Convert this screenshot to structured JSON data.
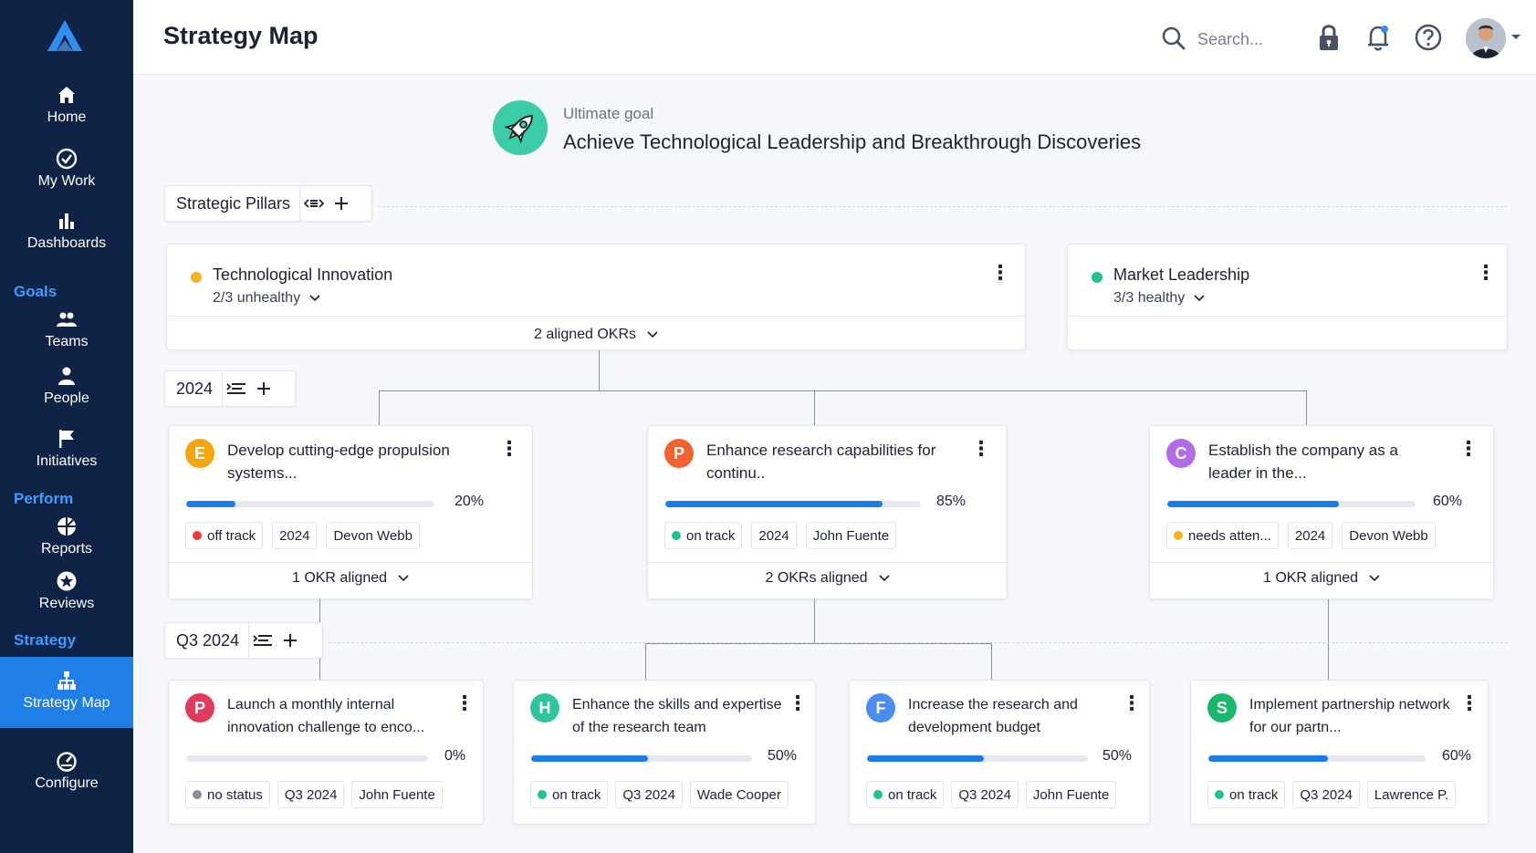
{
  "sidebar": {
    "items": [
      {
        "label": "Home",
        "icon": "home-icon"
      },
      {
        "label": "My Work",
        "icon": "check-circle-icon"
      },
      {
        "label": "Dashboards",
        "icon": "bar-chart-icon"
      },
      {
        "label": "Teams",
        "icon": "teams-icon"
      },
      {
        "label": "People",
        "icon": "person-icon"
      },
      {
        "label": "Initiatives",
        "icon": "flag-icon"
      },
      {
        "label": "Reports",
        "icon": "reports-icon"
      },
      {
        "label": "Reviews",
        "icon": "star-circle-icon"
      },
      {
        "label": "Strategy Map",
        "icon": "hierarchy-icon"
      },
      {
        "label": "Configure",
        "icon": "gauge-icon"
      }
    ],
    "sections": [
      "Goals",
      "Perform",
      "Strategy"
    ]
  },
  "header": {
    "title": "Strategy Map",
    "search_placeholder": "Search..."
  },
  "goal": {
    "label": "Ultimate goal",
    "title": "Achieve Technological Leadership and Breakthrough Discoveries"
  },
  "rows": {
    "pillars": "Strategic Pillars",
    "year": "2024",
    "quarter": "Q3 2024"
  },
  "pillars": [
    {
      "title": "Technological Innovation",
      "health": "2/3 unhealthy",
      "aligned": "2 aligned OKRs",
      "dot_color": "#f5b21b"
    },
    {
      "title": "Market Leadership",
      "health": "3/3 healthy",
      "dot_color": "#1fc48b"
    }
  ],
  "okrs_2024": [
    {
      "letter": "E",
      "letter_color": "#f5a50b",
      "title": "Develop cutting-edge propulsion systems...",
      "progress": 20,
      "progress_label": "20%",
      "status": "off track",
      "status_color": "#ef3b3b",
      "period": "2024",
      "owner": "Devon Webb",
      "aligned": "1 OKR aligned"
    },
    {
      "letter": "P",
      "letter_color": "#f2622e",
      "title": "Enhance research capabilities for continu..",
      "progress": 85,
      "progress_label": "85%",
      "status": "on track",
      "status_color": "#1fc48b",
      "period": "2024",
      "owner": "John Fuente",
      "aligned": "2 OKRs aligned"
    },
    {
      "letter": "C",
      "letter_color": "#b46be6",
      "title": "Establish the company as a leader in the...",
      "progress": 60,
      "progress_label": "60%",
      "status": "needs atten...",
      "status_color": "#f5b21b",
      "period": "2024",
      "owner": "Devon Webb",
      "aligned": "1 OKR aligned"
    }
  ],
  "okrs_q3": [
    {
      "letter": "P",
      "letter_color": "#e23a5e",
      "title": "Launch a monthly internal innovation challenge to enco...",
      "progress": 0,
      "progress_label": "0%",
      "status": "no status",
      "status_color": "#8a8f99",
      "period": "Q3 2024",
      "owner": "John Fuente"
    },
    {
      "letter": "H",
      "letter_color": "#2ec4a0",
      "title": "Enhance the skills and expertise of the research team",
      "progress": 50,
      "progress_label": "50%",
      "status": "on track",
      "status_color": "#1fc48b",
      "period": "Q3 2024",
      "owner": "Wade Cooper"
    },
    {
      "letter": "F",
      "letter_color": "#4a8cf0",
      "title": "Increase the research and development budget",
      "progress": 50,
      "progress_label": "50%",
      "status": "on track",
      "status_color": "#1fc48b",
      "period": "Q3 2024",
      "owner": "John Fuente"
    },
    {
      "letter": "S",
      "letter_color": "#19b86c",
      "title": "Implement partnership network for our partn...",
      "progress": 60,
      "progress_label": "60%",
      "status": "on track",
      "status_color": "#1fc48b",
      "period": "Q3 2024",
      "owner": "Lawrence P."
    }
  ]
}
